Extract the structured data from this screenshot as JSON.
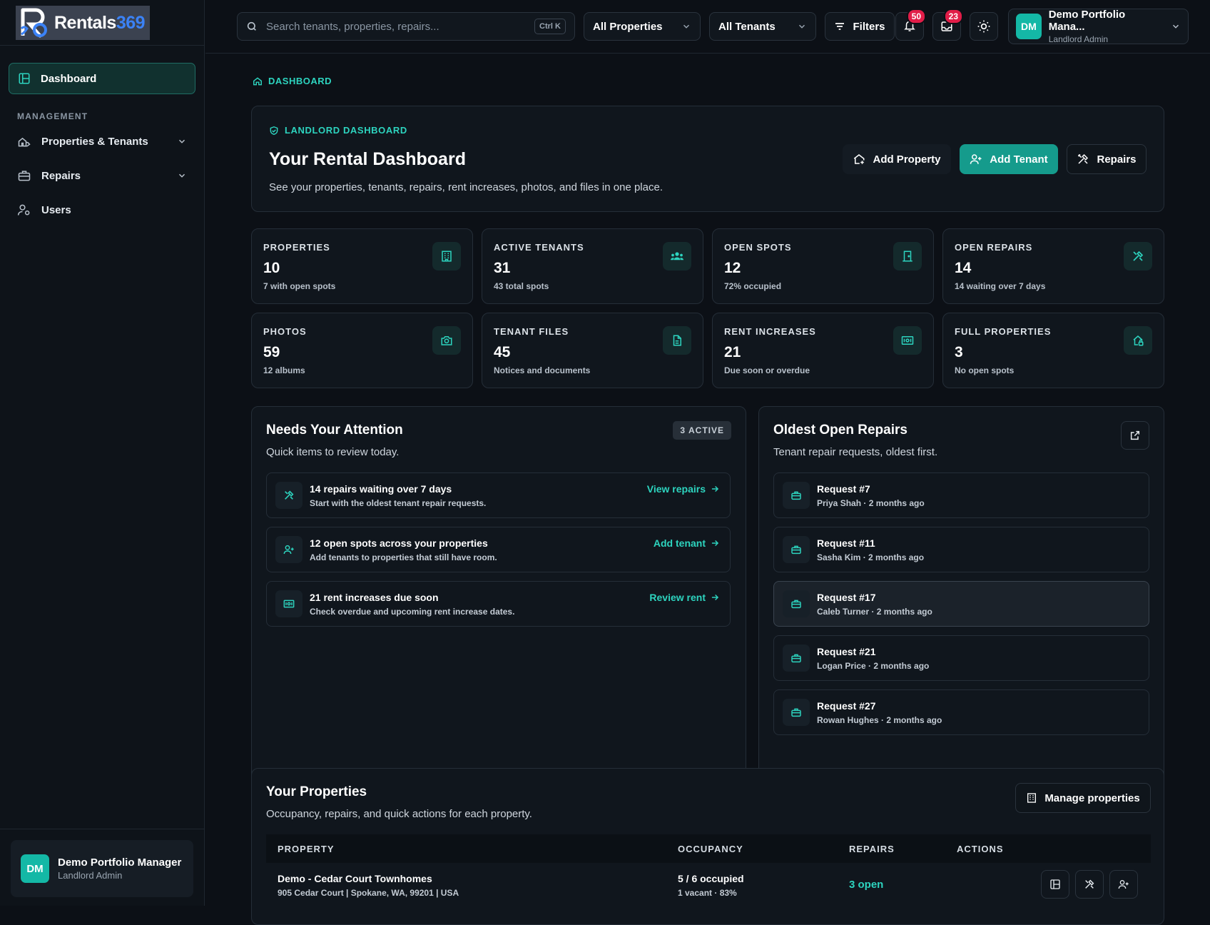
{
  "app": {
    "name_main": "Rentals",
    "name_num": "369"
  },
  "sidebar": {
    "dashboard": "Dashboard",
    "section": "MANAGEMENT",
    "items": [
      {
        "label": "Properties & Tenants"
      },
      {
        "label": "Repairs"
      },
      {
        "label": "Users"
      }
    ],
    "user": {
      "initials": "DM",
      "name": "Demo Portfolio Manager",
      "role": "Landlord Admin"
    }
  },
  "topbar": {
    "search_placeholder": "Search tenants, properties, repairs...",
    "shortcut": "Ctrl K",
    "properties_filter": "All Properties",
    "tenants_filter": "All Tenants",
    "filters": "Filters",
    "notifications_count": "50",
    "messages_count": "23",
    "user": {
      "initials": "DM",
      "name": "Demo Portfolio Mana...",
      "role": "Landlord Admin"
    }
  },
  "breadcrumb": "DASHBOARD",
  "hero": {
    "tag": "LANDLORD DASHBOARD",
    "title": "Your Rental Dashboard",
    "subtitle": "See your properties, tenants, repairs, rent increases, photos, and files in one place.",
    "add_property": "Add Property",
    "add_tenant": "Add Tenant",
    "repairs": "Repairs"
  },
  "stats": [
    {
      "label": "PROPERTIES",
      "value": "10",
      "sub": "7 with open spots",
      "icon": "building-icon"
    },
    {
      "label": "ACTIVE TENANTS",
      "value": "31",
      "sub": "43 total spots",
      "icon": "users-icon"
    },
    {
      "label": "OPEN SPOTS",
      "value": "12",
      "sub": "72% occupied",
      "icon": "door-icon"
    },
    {
      "label": "OPEN REPAIRS",
      "value": "14",
      "sub": "14 waiting over 7 days",
      "icon": "tools-icon"
    },
    {
      "label": "PHOTOS",
      "value": "59",
      "sub": "12 albums",
      "icon": "camera-icon"
    },
    {
      "label": "TENANT FILES",
      "value": "45",
      "sub": "Notices and documents",
      "icon": "file-icon"
    },
    {
      "label": "RENT INCREASES",
      "value": "21",
      "sub": "Due soon or overdue",
      "icon": "money-icon"
    },
    {
      "label": "FULL PROPERTIES",
      "value": "3",
      "sub": "No open spots",
      "icon": "lock-home-icon"
    }
  ],
  "attention": {
    "title": "Needs Your Attention",
    "subtitle": "Quick items to review today.",
    "chip": "3 ACTIVE",
    "items": [
      {
        "title": "14 repairs waiting over 7 days",
        "sub": "Start with the oldest tenant repair requests.",
        "link": "View repairs"
      },
      {
        "title": "12 open spots across your properties",
        "sub": "Add tenants to properties that still have room.",
        "link": "Add tenant"
      },
      {
        "title": "21 rent increases due soon",
        "sub": "Check overdue and upcoming rent increase dates.",
        "link": "Review rent"
      }
    ]
  },
  "repairs": {
    "title": "Oldest Open Repairs",
    "subtitle": "Tenant repair requests, oldest first.",
    "items": [
      {
        "title": "Request #7",
        "sub": "Priya Shah · 2 months ago"
      },
      {
        "title": "Request #11",
        "sub": "Sasha Kim · 2 months ago"
      },
      {
        "title": "Request #17",
        "sub": "Caleb Turner · 2 months ago"
      },
      {
        "title": "Request #21",
        "sub": "Logan Price · 2 months ago"
      },
      {
        "title": "Request #27",
        "sub": "Rowan Hughes · 2 months ago"
      }
    ]
  },
  "properties": {
    "title": "Your Properties",
    "subtitle": "Occupancy, repairs, and quick actions for each property.",
    "manage": "Manage properties",
    "columns": [
      "PROPERTY",
      "OCCUPANCY",
      "REPAIRS",
      "ACTIONS"
    ],
    "rows": [
      {
        "name": "Demo - Cedar Court Townhomes",
        "address": "905 Cedar Court | Spokane, WA, 99201 | USA",
        "occupancy": "5 / 6 occupied",
        "occupancy_sub": "1 vacant · 83%",
        "repairs": "3 open"
      }
    ]
  },
  "colors": {
    "accent": "#2dd4bf",
    "teal_button": "#159b8c",
    "badge": "#e11d48",
    "background": "#0c1016"
  }
}
